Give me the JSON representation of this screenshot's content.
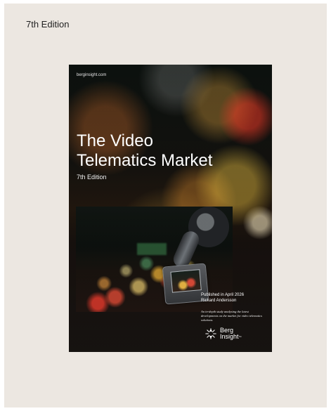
{
  "page": {
    "edition_label": "7th Edition"
  },
  "cover": {
    "website": "berginsight.com",
    "title_line_1": "The Video",
    "title_line_2": "Telematics Market",
    "subtitle": "7th Edition",
    "published": "Published in April 2026",
    "author": "Rickard Andersson",
    "description": "An in-depth study analysing the latest developments on the market for video telematics solutions.",
    "brand_line_1": "Berg",
    "brand_line_2": "Insight",
    "brand_tm": "™"
  },
  "icons": {
    "brand": "sunburst-logo-icon"
  },
  "colors": {
    "background": "#ece7e1",
    "text": "#1f1f1f",
    "cover_text": "#ffffff"
  }
}
